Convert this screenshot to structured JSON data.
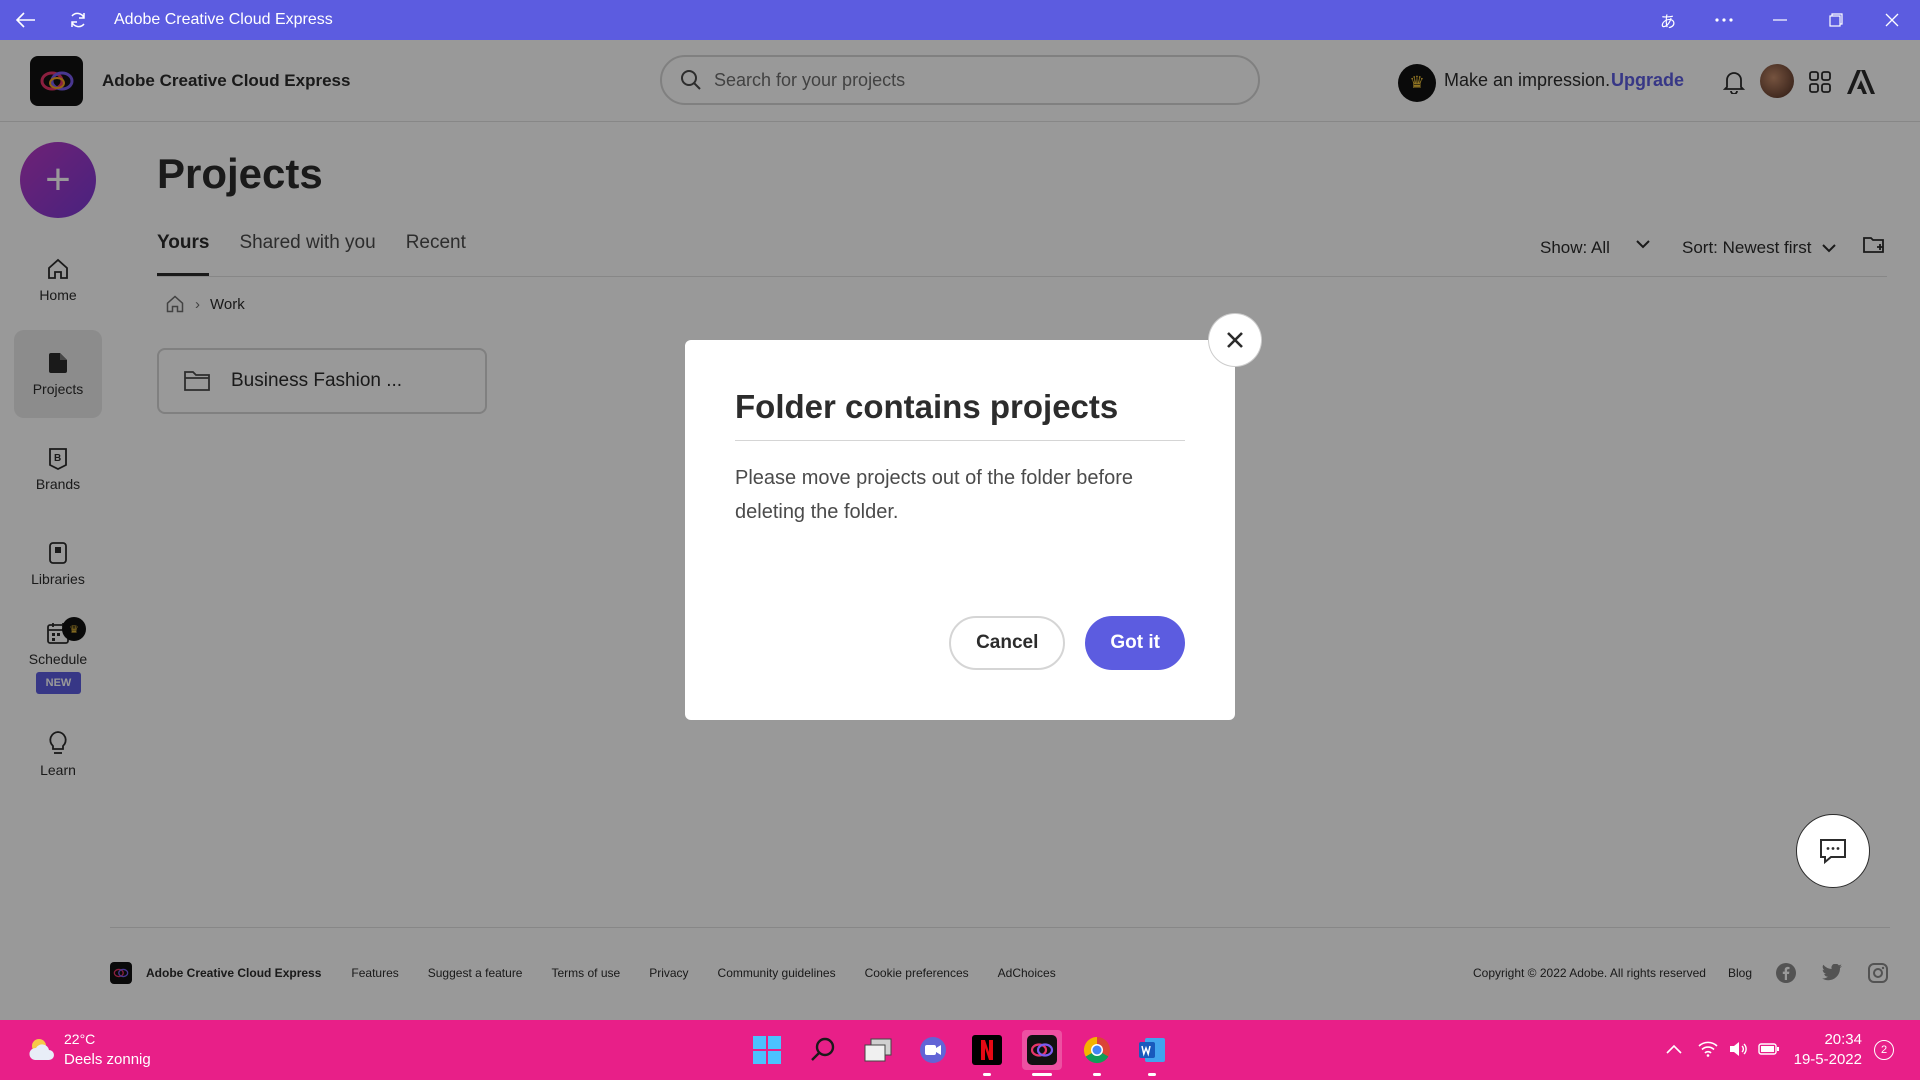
{
  "window": {
    "title": "Adobe Creative Cloud Express",
    "lang_glyph": "あ"
  },
  "header": {
    "app_name": "Adobe Creative Cloud Express",
    "search_placeholder": "Search for your projects",
    "promo_text": "Make an impression.",
    "upgrade_label": "Upgrade"
  },
  "sidebar": {
    "items": [
      {
        "label": "Home"
      },
      {
        "label": "Projects"
      },
      {
        "label": "Brands"
      },
      {
        "label": "Libraries"
      },
      {
        "label": "Schedule"
      },
      {
        "label": "Learn"
      }
    ],
    "new_badge": "NEW"
  },
  "main": {
    "title": "Projects",
    "tabs": [
      {
        "label": "Yours"
      },
      {
        "label": "Shared with you"
      },
      {
        "label": "Recent"
      }
    ],
    "show_filter": "Show: All",
    "sort_filter": "Sort: Newest first",
    "breadcrumb_current": "Work",
    "folder_name": "Business Fashion ..."
  },
  "dialog": {
    "title": "Folder contains projects",
    "body": "Please move projects out of the folder before deleting the folder.",
    "cancel_label": "Cancel",
    "confirm_label": "Got it"
  },
  "footer": {
    "brand": "Adobe Creative Cloud Express",
    "links": [
      "Features",
      "Suggest a feature",
      "Terms of use",
      "Privacy",
      "Community guidelines",
      "Cookie preferences",
      "AdChoices"
    ],
    "copyright": "Copyright © 2022 Adobe. All rights reserved",
    "blog": "Blog"
  },
  "taskbar": {
    "temperature": "22°C",
    "condition": "Deels zonnig",
    "time": "20:34",
    "date": "19-5-2022",
    "notification_count": "2"
  },
  "colors": {
    "accent": "#5c5ce0",
    "taskbar": "#e81f88",
    "premium_crown": "#f2c43b"
  }
}
